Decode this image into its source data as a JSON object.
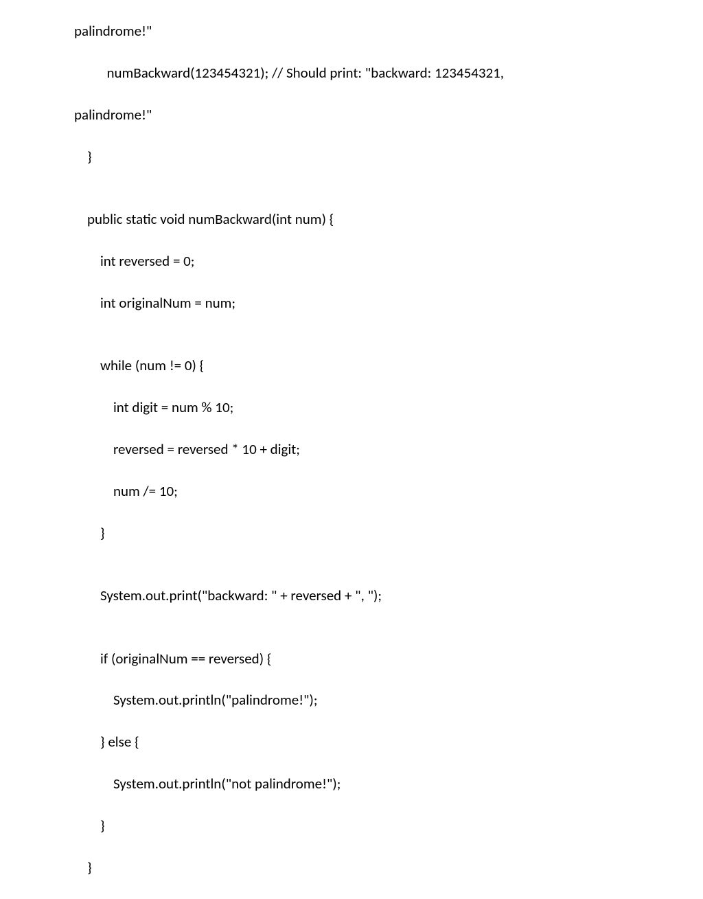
{
  "code": {
    "l01": "palindrome!\"",
    "l02": "          numBackward(123454321); // Should print: \"backward: 123454321,",
    "l03": "palindrome!\"",
    "l04": "    }",
    "l05": "",
    "l06": "    public static void numBackward(int num) {",
    "l07": "        int reversed = 0;",
    "l08": "        int originalNum = num;",
    "l09": "",
    "l10": "        while (num != 0) {",
    "l11": "            int digit = num % 10;",
    "l12": "            reversed = reversed * 10 + digit;",
    "l13": "            num /= 10;",
    "l14": "        }",
    "l15": "",
    "l16": "        System.out.print(\"backward: \" + reversed + \", \");",
    "l17": "",
    "l18": "        if (originalNum == reversed) {",
    "l19": "            System.out.println(\"palindrome!\");",
    "l20": "        } else {",
    "l21": "            System.out.println(\"not palindrome!\");",
    "l22": "        }",
    "l23": "    }"
  }
}
